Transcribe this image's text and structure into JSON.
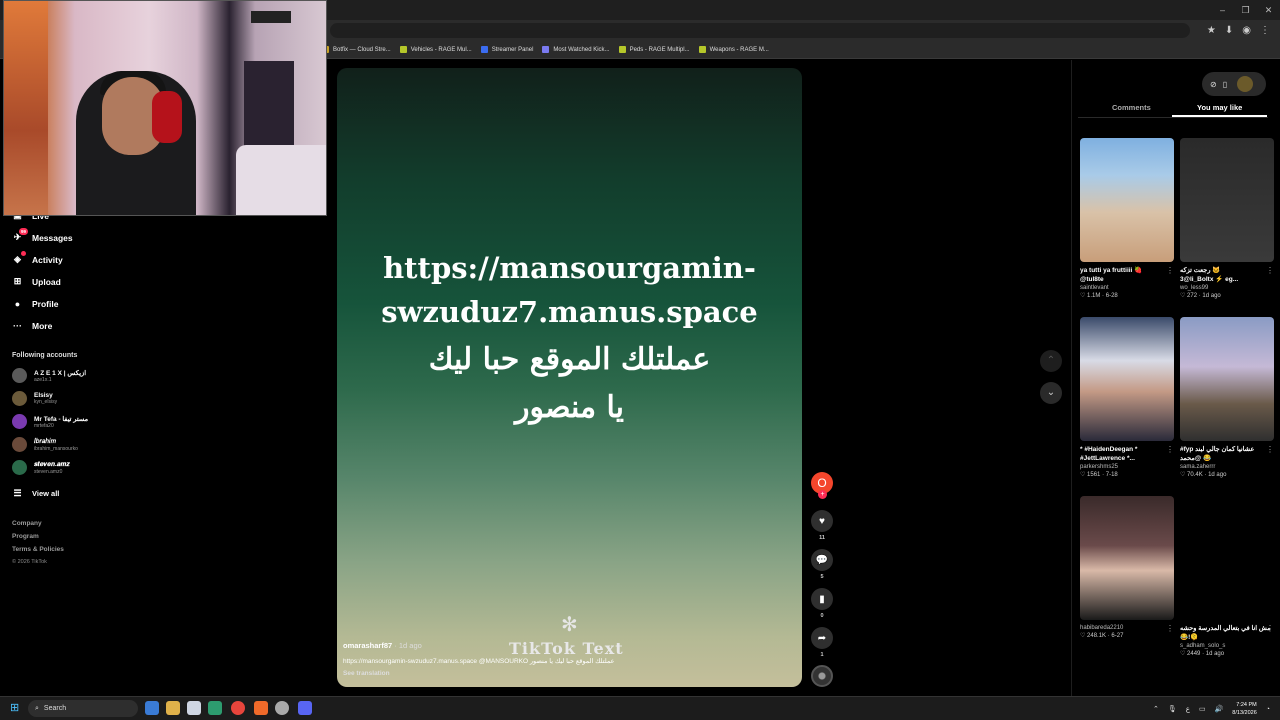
{
  "browser": {
    "window_controls": [
      "–",
      "❐",
      "✕"
    ],
    "bookmarks": [
      {
        "label": "Botfix — Cloud Stre...",
        "color": "#c9a227"
      },
      {
        "label": "Vehicles - RAGE Mul...",
        "color": "#b5c72a"
      },
      {
        "label": "Streamer Panel",
        "color": "#3b6cf0"
      },
      {
        "label": "Most Watched Kick...",
        "color": "#7a7af0"
      },
      {
        "label": "Peds - RAGE Multipl...",
        "color": "#b5c72a"
      },
      {
        "label": "Weapons - RAGE M...",
        "color": "#b5c72a"
      }
    ],
    "toolbar_icons": [
      "★",
      "⬇",
      "◉",
      "⋮"
    ]
  },
  "sidebar": {
    "nav": [
      {
        "label": "Live",
        "icon": "live-icon",
        "glyph": "▣"
      },
      {
        "label": "Messages",
        "icon": "messages-icon",
        "glyph": "✈",
        "badge": "99"
      },
      {
        "label": "Activity",
        "icon": "activity-icon",
        "glyph": "◈",
        "dot": true
      },
      {
        "label": "Upload",
        "icon": "upload-icon",
        "glyph": "⊞"
      },
      {
        "label": "Profile",
        "icon": "profile-icon",
        "glyph": "●"
      },
      {
        "label": "More",
        "icon": "more-icon",
        "glyph": "···"
      }
    ],
    "following_title": "Following accounts",
    "accounts": [
      {
        "name": "A Z E 1 X | ازيكس",
        "handle": "aze1x.1",
        "color": "#5a5a5a"
      },
      {
        "name": "Elsisy",
        "handle": "kyn_elsisy",
        "color": "#6b5a3a"
      },
      {
        "name": "Mr Tefa - مستر تيفا",
        "handle": "mrtefa20",
        "color": "#7a3ab0"
      },
      {
        "name": "𝐼𝑏𝑟𝑎ℎ𝑖𝑚",
        "handle": "ibrahim_mansourko",
        "color": "#6a4a3a"
      },
      {
        "name": "𝒔𝒕𝒆𝒗𝒆𝒏.𝒂𝒎𝒛",
        "handle": "steven.amz0",
        "color": "#2a6a4a"
      }
    ],
    "view_all": "View all",
    "footer": [
      "Company",
      "Program",
      "Terms & Policies"
    ],
    "copyright": "© 2026 TikTok"
  },
  "video": {
    "url_line1": "https://mansourgamin-",
    "url_line2": "swzuduz7.manus.space",
    "arabic_line1": "عملتلك الموقع حبا ليك",
    "arabic_line2": "يا منصور",
    "watermark_star": "✻",
    "watermark_text": "TikTok  Text",
    "author": "omarasharf87",
    "time": " · 1d ago",
    "caption": "https://mansourgamin-swzuduz7.manus.space @MANSOURKO عملتلك الموقع حبا ليك يا منصور",
    "see_translation": "See translation"
  },
  "actions": {
    "avatar_letter": "O",
    "plus": "+",
    "likes": "11",
    "comments": "5",
    "saves": "0",
    "shares": "1"
  },
  "nav_arrows": {
    "up": "⌃",
    "down": "⌄"
  },
  "right_panel": {
    "tab_comments": "Comments",
    "tab_you_may_like": "You may like",
    "cards": [
      {
        "title": "ya tutti ya fruttiiii 🍓",
        "title2": "@tul8te",
        "user": "saintlevant",
        "views": "1.1M",
        "date": "6-28"
      },
      {
        "title": "رجعت تزكه 🐱",
        "title2": "3@li_Boltx ⚡ eg...",
        "user": "wo_less99",
        "views": "272",
        "date": "1d ago"
      },
      {
        "title": "* #HaidenDeegan *",
        "title2": "#JettLawrence *...",
        "user": "parkershms25",
        "views": "1561",
        "date": "7-18"
      },
      {
        "title": "#fyp عشانيا كمان جالي لبند",
        "title2": "محمد@ 😂",
        "user": "sama.zaherrr",
        "views": "70.4K",
        "date": "1d ago"
      },
      {
        "title": "",
        "title2": "",
        "user": "habibareda2210",
        "views": "248.1K",
        "date": "6-27"
      },
      {
        "title": "مش انا في بتعالي المدرسة وحشه",
        "title2": "😂!🫠",
        "user": "s_adham_solo_s",
        "views": "2449",
        "date": "1d ago"
      }
    ]
  },
  "taskbar": {
    "search": "Search",
    "lang": "ع",
    "time": "7:24 PM",
    "date": "8/13/2026"
  }
}
